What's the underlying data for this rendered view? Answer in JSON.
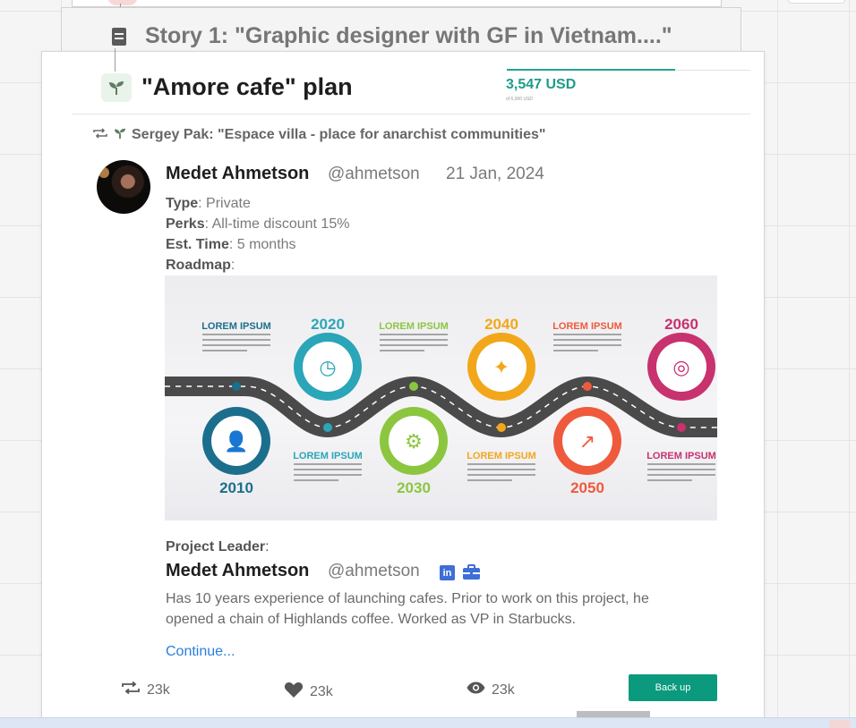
{
  "story": {
    "title": "Story 1: \"Graphic designer with GF in Vietnam....\""
  },
  "plan": {
    "title": "\"Amore cafe\" plan",
    "funding": {
      "amount": "3,547 USD",
      "goal": "of 6,000 USD",
      "progress_fraction": 0.69,
      "accent": "#1c9d87"
    }
  },
  "repost": {
    "text": "Sergey Pak: \"Espace villa - place for anarchist communities\""
  },
  "post": {
    "author_name": "Medet Ahmetson",
    "author_handle": "@ahmetson",
    "date": "21 Jan, 2024",
    "type_label": "Type",
    "type_value": ": Private",
    "perks_label": "Perks",
    "perks_value": ": All-time discount 15%",
    "time_label": "Est. Time",
    "time_value": ": 5 months",
    "roadmap_label": "Roadmap",
    "roadmap_suffix": ":"
  },
  "roadmap": {
    "milestones": [
      {
        "year": "2010",
        "heading": "LOREM IPSUM",
        "color": "#1b6f8c",
        "icon": "person-icon"
      },
      {
        "year": "2020",
        "heading": "LOREM IPSUM",
        "color": "#2aa6b8",
        "icon": "clock-icon"
      },
      {
        "year": "2030",
        "heading": "LOREM IPSUM",
        "color": "#8cc63f",
        "icon": "gears-icon"
      },
      {
        "year": "2040",
        "heading": "LOREM IPSUM",
        "color": "#f2a71b",
        "icon": "handshake-icon"
      },
      {
        "year": "2050",
        "heading": "LOREM IPSUM",
        "color": "#ef5a3c",
        "icon": "chart-icon"
      },
      {
        "year": "2060",
        "heading": "LOREM IPSUM",
        "color": "#c8326e",
        "icon": "globe-icon"
      }
    ]
  },
  "leader": {
    "label": "Project Leader",
    "label_suffix": ":",
    "name": "Medet Ahmetson",
    "handle": "@ahmetson",
    "linkedin_text": "in",
    "bio": "Has 10 years experience of launching cafes. Prior to work on this project, he opened a chain of Highlands coffee. Worked as VP in Starbucks.",
    "continue": "Continue..."
  },
  "stats": {
    "reposts": "23k",
    "likes": "23k",
    "views": "23k"
  },
  "actions": {
    "backup": "Back up",
    "backup_color": "#0b9a7d"
  }
}
